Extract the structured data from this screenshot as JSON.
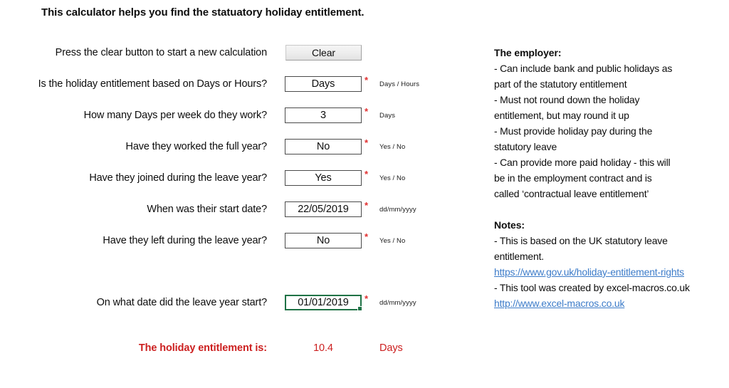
{
  "title": "This calculator helps you find the statuatory holiday entitlement.",
  "form": {
    "clear_row": {
      "label": "Press the clear button to start a new calculation",
      "button_label": "Clear"
    },
    "required_marker": "*",
    "rows": [
      {
        "label": "Is the holiday entitlement based on Days or Hours?",
        "value": "Days",
        "hint": "Days / Hours",
        "selected": false
      },
      {
        "label": "How many Days per week do they work?",
        "value": "3",
        "hint": "Days",
        "selected": false
      },
      {
        "label": "Have they worked the full year?",
        "value": "No",
        "hint": "Yes / No",
        "selected": false
      },
      {
        "label": "Have they joined during the leave year?",
        "value": "Yes",
        "hint": "Yes / No",
        "selected": false
      },
      {
        "label": "When was their start date?",
        "value": "22/05/2019",
        "hint": "dd/mm/yyyy",
        "selected": false
      },
      {
        "label": "Have they left during the leave year?",
        "value": "No",
        "hint": "Yes / No",
        "selected": false
      },
      {
        "label": "On what date did the leave year start?",
        "value": "01/01/2019",
        "hint": "dd/mm/yyyy",
        "selected": true
      }
    ],
    "result": {
      "label": "The holiday entitlement is:",
      "value": "10.4",
      "unit": "Days"
    }
  },
  "info": {
    "employer_heading": "The employer:",
    "employer_lines": [
      "- Can include bank and public holidays as",
      "part of the statutory entitlement",
      "- Must not round down the holiday",
      "entitlement, but may round it up",
      "- Must provide holiday pay during the",
      "statutory leave",
      "- Can provide more paid holiday - this will",
      "be in the employment contract and is",
      "called ‘contractual leave entitlement’"
    ],
    "notes_heading": "Notes:",
    "notes_lines": [
      "- This is based on the UK statutory leave",
      "entitlement."
    ],
    "gov_link": "https://www.gov.uk/holiday-entitlement-rights",
    "credit_line": "- This tool was created by excel-macros.co.uk",
    "credit_link": "http://www.excel-macros.co.uk"
  },
  "colors": {
    "required": "#e03030",
    "result": "#cc2020",
    "selection": "#1f7246",
    "link": "#3d7cc9"
  }
}
